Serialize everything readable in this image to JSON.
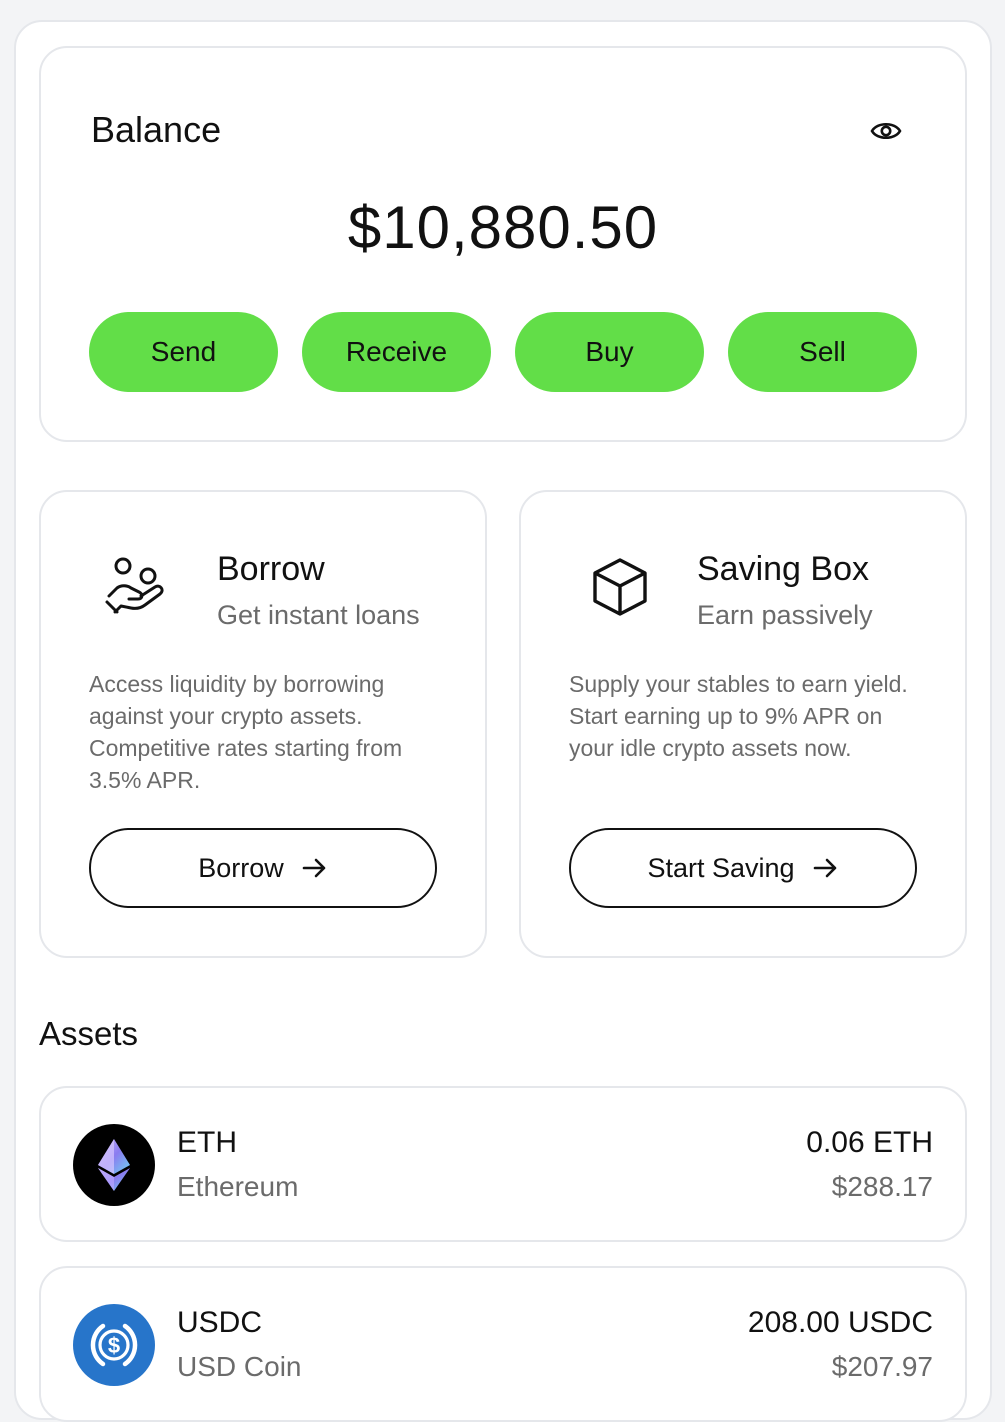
{
  "balance": {
    "title": "Balance",
    "amount": "$10,880.50",
    "actions": [
      "Send",
      "Receive",
      "Buy",
      "Sell"
    ]
  },
  "features": [
    {
      "icon": "hand-coins-icon",
      "title": "Borrow",
      "subtitle": "Get instant loans",
      "description": "Access liquidity by borrowing against your crypto assets. Competitive rates starting from 3.5% APR.",
      "button": "Borrow"
    },
    {
      "icon": "box-icon",
      "title": "Saving Box",
      "subtitle": "Earn passively",
      "description": "Supply your stables to earn yield. Start earning up to 9% APR on your idle crypto assets now.",
      "button": "Start Saving"
    }
  ],
  "assets": {
    "title": "Assets",
    "items": [
      {
        "symbol": "ETH",
        "name": "Ethereum",
        "amount": "0.06 ETH",
        "usd": "$288.17",
        "icon": "ethereum-logo-icon"
      },
      {
        "symbol": "USDC",
        "name": "USD Coin",
        "amount": "208.00 USDC",
        "usd": "$207.97",
        "icon": "usdc-logo-icon"
      }
    ]
  },
  "colors": {
    "accent": "#62de48",
    "border": "#e5e7eb",
    "muted_text": "#6b6b6b",
    "usdc_blue": "#2775ca"
  }
}
